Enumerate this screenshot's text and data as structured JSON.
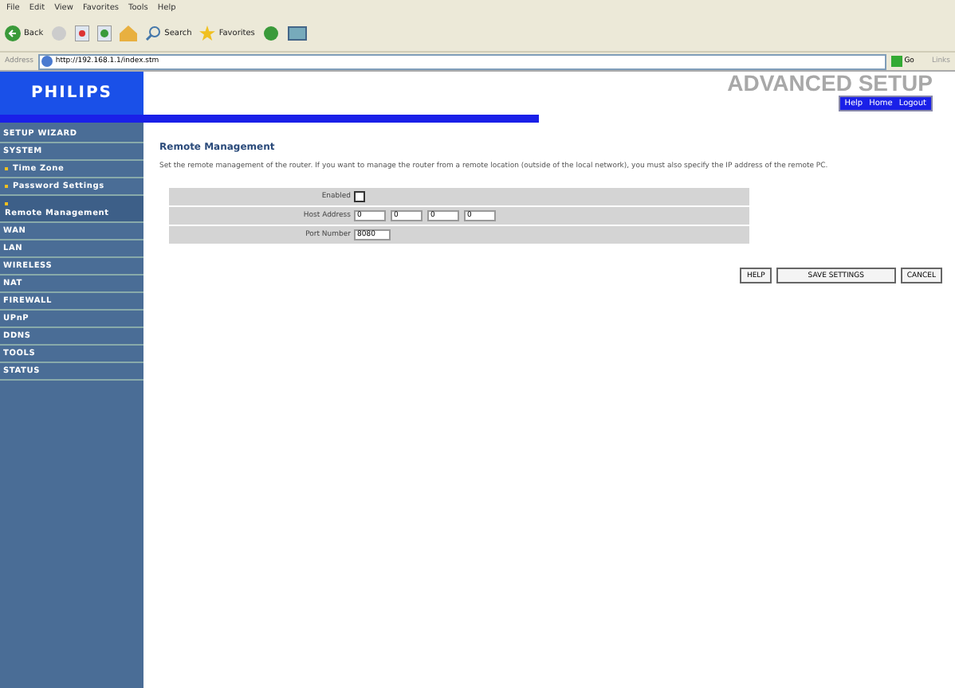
{
  "browser": {
    "menu": [
      "File",
      "Edit",
      "View",
      "Favorites",
      "Tools",
      "Help"
    ],
    "toolbar": {
      "back": "Back",
      "search": "Search",
      "favorites": "Favorites"
    },
    "address": {
      "label": "Address",
      "value": "http://192.168.1.1/index.stm",
      "go": "Go",
      "links": "Links"
    }
  },
  "header": {
    "logo": "PHILIPS",
    "title": "ADVANCED SETUP",
    "links": [
      "Help",
      "Home",
      "Logout"
    ]
  },
  "sidebar": {
    "items": [
      {
        "label": "SETUP WIZARD",
        "kind": "section",
        "selected": false
      },
      {
        "label": "SYSTEM",
        "kind": "section",
        "selected": false
      },
      {
        "label": "Time Zone",
        "kind": "sub",
        "selected": false
      },
      {
        "label": "Password Settings",
        "kind": "sub",
        "selected": false
      },
      {
        "label": "Remote Management",
        "kind": "sub",
        "selected": true
      },
      {
        "label": "WAN",
        "kind": "section",
        "selected": false
      },
      {
        "label": "LAN",
        "kind": "section",
        "selected": false
      },
      {
        "label": "WIRELESS",
        "kind": "section",
        "selected": false
      },
      {
        "label": "NAT",
        "kind": "section",
        "selected": false
      },
      {
        "label": "FIREWALL",
        "kind": "section",
        "selected": false
      },
      {
        "label": "UPnP",
        "kind": "section",
        "selected": false
      },
      {
        "label": "DDNS",
        "kind": "section",
        "selected": false
      },
      {
        "label": "TOOLS",
        "kind": "section",
        "selected": false
      },
      {
        "label": "STATUS",
        "kind": "section",
        "selected": false
      }
    ]
  },
  "content": {
    "title": "Remote Management",
    "description": "Set the remote management of the router. If you want to manage the router from a remote location (outside of the local network), you must also specify the IP address of the remote PC.",
    "form": {
      "enabled": {
        "label": "Enabled",
        "checked": false
      },
      "host": {
        "label": "Host Address",
        "values": [
          "0",
          "0",
          "0",
          "0"
        ]
      },
      "port": {
        "label": "Port Number",
        "value": "8080"
      }
    },
    "buttons": [
      "HELP",
      "SAVE SETTINGS",
      "CANCEL"
    ]
  }
}
